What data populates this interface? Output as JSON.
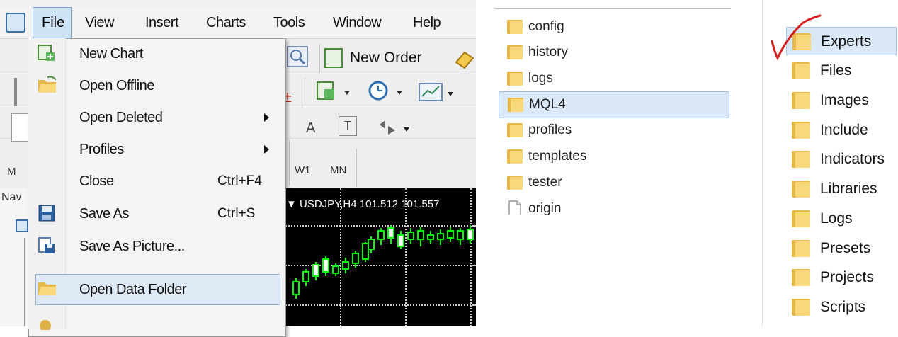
{
  "menubar": {
    "items": [
      "File",
      "View",
      "Insert",
      "Charts",
      "Tools",
      "Window",
      "Help"
    ]
  },
  "toolbar": {
    "new_order_label": "New Order",
    "text_tool_a": "A",
    "text_tool_t": "T",
    "timeframes": [
      "W1",
      "MN"
    ]
  },
  "side": {
    "partial_labels": [
      "M",
      "Nav"
    ]
  },
  "chart": {
    "title": "▼ USDJPY,H4  101.512 101.557"
  },
  "file_menu": {
    "items": [
      {
        "label": "New Chart",
        "shortcut": "",
        "submenu": false,
        "icon": "new-chart-icon"
      },
      {
        "label": "Open Offline",
        "shortcut": "",
        "submenu": false,
        "icon": "open-folder-icon"
      },
      {
        "label": "Open Deleted",
        "shortcut": "",
        "submenu": true,
        "icon": ""
      },
      {
        "label": "Profiles",
        "shortcut": "",
        "submenu": true,
        "icon": ""
      },
      {
        "label": "Close",
        "shortcut": "Ctrl+F4",
        "submenu": false,
        "icon": ""
      },
      {
        "label": "Save As",
        "shortcut": "Ctrl+S",
        "submenu": false,
        "icon": "save-icon"
      },
      {
        "label": "Save As Picture...",
        "shortcut": "",
        "submenu": false,
        "icon": "save-picture-icon"
      },
      {
        "label": "Open Data Folder",
        "shortcut": "",
        "submenu": false,
        "icon": "open-folder-icon",
        "highlighted": true
      }
    ]
  },
  "data_folder": {
    "items": [
      {
        "label": "config",
        "type": "folder"
      },
      {
        "label": "history",
        "type": "folder"
      },
      {
        "label": "logs",
        "type": "folder"
      },
      {
        "label": "MQL4",
        "type": "folder",
        "selected": true
      },
      {
        "label": "profiles",
        "type": "folder"
      },
      {
        "label": "templates",
        "type": "folder"
      },
      {
        "label": "tester",
        "type": "folder"
      },
      {
        "label": "origin",
        "type": "file"
      }
    ]
  },
  "mql4_folder": {
    "items": [
      {
        "label": "Experts",
        "selected": true,
        "checkmark": true
      },
      {
        "label": "Files"
      },
      {
        "label": "Images"
      },
      {
        "label": "Include"
      },
      {
        "label": "Indicators"
      },
      {
        "label": "Libraries"
      },
      {
        "label": "Logs"
      },
      {
        "label": "Presets"
      },
      {
        "label": "Projects"
      },
      {
        "label": "Scripts"
      }
    ]
  },
  "colors": {
    "menu_highlight": "#dfe9f5",
    "selection": "#dbe8f7",
    "folder": "#f8d879",
    "candle_up": "#00ff00",
    "checkmark": "#d42020"
  }
}
